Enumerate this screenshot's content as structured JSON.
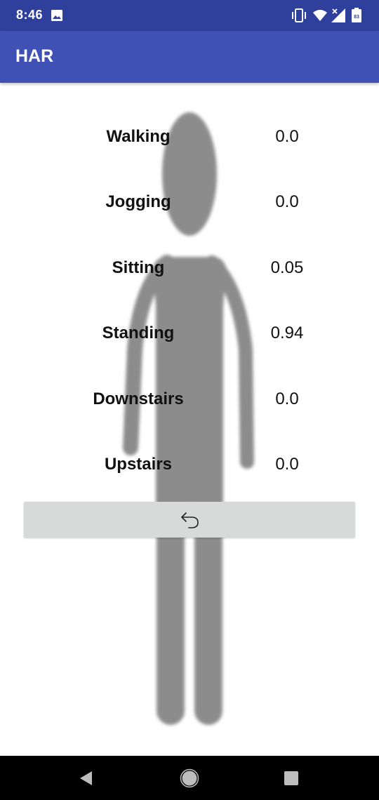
{
  "status_bar": {
    "time": "8:46",
    "battery_level": "83",
    "icons": [
      "image-icon",
      "vibrate-icon",
      "wifi-icon",
      "signal-icon",
      "battery-icon"
    ]
  },
  "app_bar": {
    "title": "HAR"
  },
  "activities": [
    {
      "label": "Walking",
      "value": "0.0"
    },
    {
      "label": "Jogging",
      "value": "0.0"
    },
    {
      "label": "Sitting",
      "value": "0.05"
    },
    {
      "label": "Standing",
      "value": "0.94"
    },
    {
      "label": "Downstairs",
      "value": "0.0"
    },
    {
      "label": "Upstairs",
      "value": "0.0"
    }
  ],
  "undo_button": {
    "icon": "undo-icon"
  },
  "nav_bar": {
    "icons": [
      "back-icon",
      "home-icon",
      "recent-apps-icon"
    ]
  },
  "colors": {
    "status_bar": "#2f3f9c",
    "app_bar": "#3f51b5",
    "silhouette": "#8c8c8c",
    "button": "#d8d9d9",
    "nav_bar": "#000000"
  }
}
